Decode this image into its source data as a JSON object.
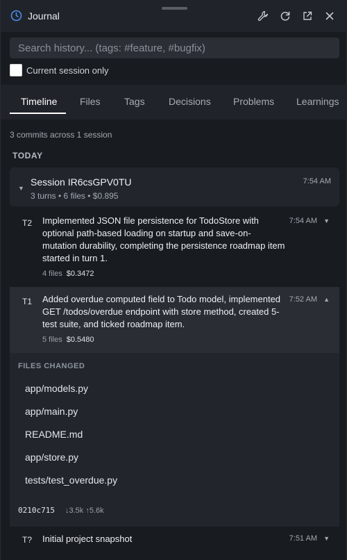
{
  "window": {
    "title": "Journal",
    "icons": {
      "app": "clock-icon",
      "settings": "wrench-icon",
      "refresh": "refresh-icon",
      "popout": "external-link-icon",
      "close": "close-icon"
    }
  },
  "search": {
    "placeholder": "Search history... (tags: #feature, #bugfix)",
    "value": ""
  },
  "filter": {
    "label": "Current session only",
    "checked": false
  },
  "tabs": [
    {
      "label": "Timeline",
      "active": true
    },
    {
      "label": "Files",
      "active": false
    },
    {
      "label": "Tags",
      "active": false
    },
    {
      "label": "Decisions",
      "active": false
    },
    {
      "label": "Problems",
      "active": false
    },
    {
      "label": "Learnings",
      "active": false
    }
  ],
  "summary": "3 commits across 1 session",
  "day_label": "TODAY",
  "session": {
    "title": "Session IR6csGPV0TU",
    "meta": "3 turns • 6 files • $0.895",
    "time": "7:54 AM",
    "toggle": "▼"
  },
  "turns": [
    {
      "id": "T2",
      "text": "Implemented JSON file persistence for TodoStore with optional path-based loading on startup and save-on-mutation durability, completing the persistence roadmap item started in turn 1.",
      "files": "4 files",
      "cost": "$0.3472",
      "time": "7:54 AM",
      "caret": "▼"
    },
    {
      "id": "T1",
      "text": "Added overdue computed field to Todo model, implemented GET /todos/overdue endpoint with store method, created 5-test suite, and ticked roadmap item.",
      "files": "5 files",
      "cost": "$0.5480",
      "time": "7:52 AM",
      "caret": "▲"
    },
    {
      "id": "T?",
      "text": "Initial project snapshot",
      "time": "7:51 AM",
      "caret": "▼"
    }
  ],
  "files_changed": {
    "heading": "FILES CHANGED",
    "items": [
      "app/models.py",
      "app/main.py",
      "README.md",
      "app/store.py",
      "tests/test_overdue.py"
    ],
    "commit_hash": "0210c715",
    "stats": "↓3.5k ↑5.6k"
  },
  "colors": {
    "background": "#181b20",
    "accent": "#3b82f6",
    "panel": "#22262c"
  }
}
